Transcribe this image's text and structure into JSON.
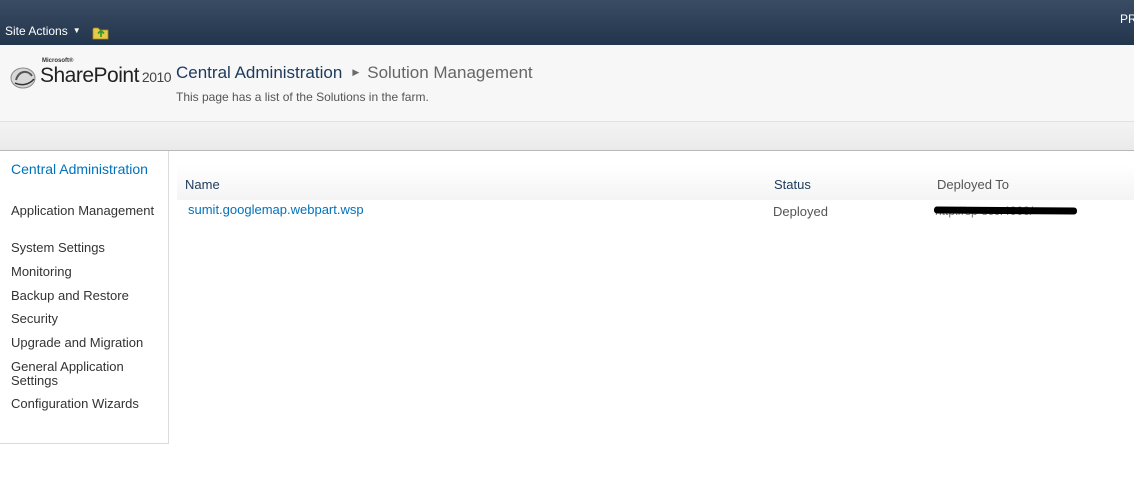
{
  "topbar": {
    "site_actions_label": "Site Actions",
    "user_menu_label": "PR",
    "navigate_up_icon": "folder-up-icon"
  },
  "brand": {
    "microsoft_label": "Microsoft®",
    "product_name": "SharePoint",
    "version": "2010"
  },
  "header": {
    "breadcrumb_root": "Central Administration",
    "breadcrumb_current": "Solution Management",
    "description": "This page has a list of the Solutions in the farm."
  },
  "quick_launch": {
    "heading": "Central Administration",
    "items": [
      {
        "label": "Application Management"
      },
      {
        "label": "System Settings"
      },
      {
        "label": "Monitoring"
      },
      {
        "label": "Backup and Restore"
      },
      {
        "label": "Security"
      },
      {
        "label": "Upgrade and Migration"
      },
      {
        "label": "General Application Settings"
      },
      {
        "label": "Configuration Wizards"
      }
    ]
  },
  "solutions_table": {
    "columns": [
      "Name",
      "Status",
      "Deployed To"
    ],
    "rows": [
      {
        "name": "sumit.googlemap.webpart.wsp",
        "status": "Deployed",
        "deployed_to": "http://sp-scc:4000/"
      }
    ]
  },
  "colors": {
    "topbar": "#21354d",
    "link": "#0072bc",
    "heading": "#1c3a5c"
  }
}
